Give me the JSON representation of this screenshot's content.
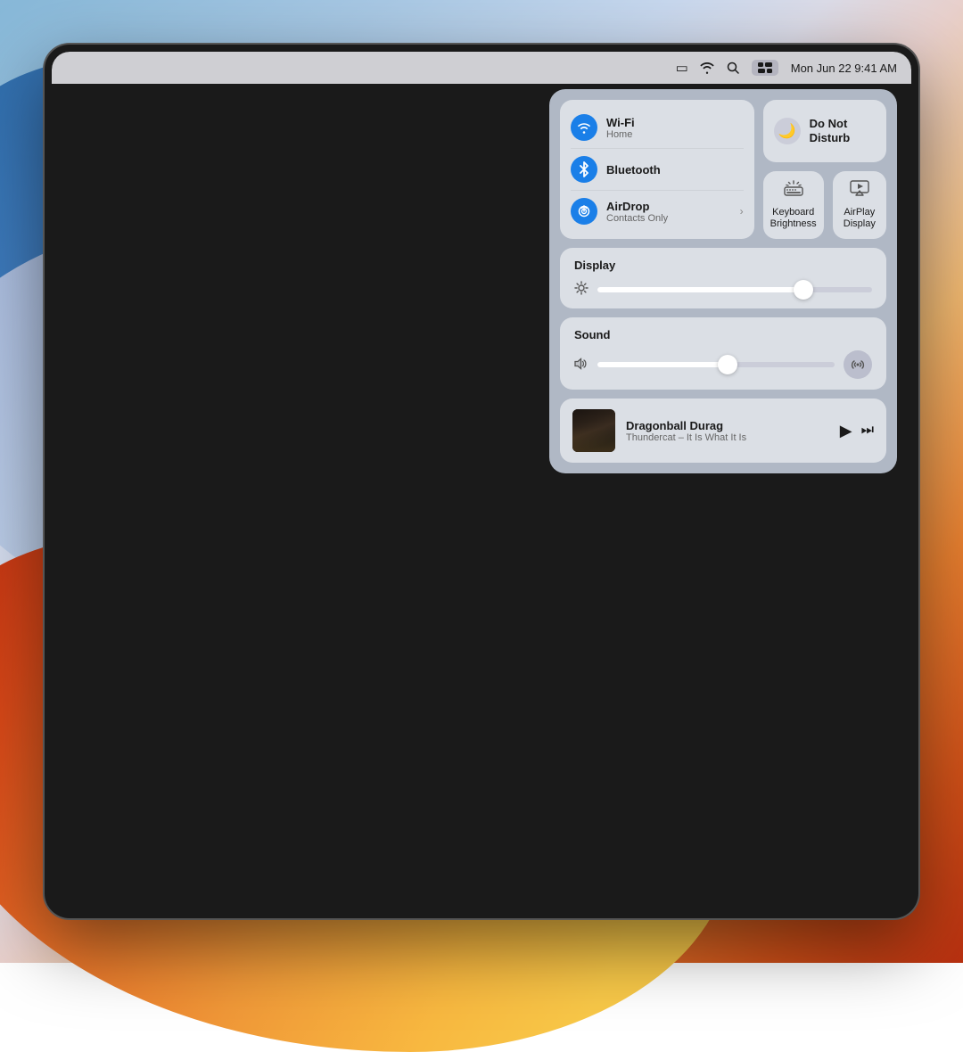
{
  "menubar": {
    "battery_icon": "▭",
    "wifi_icon": "wifi",
    "search_icon": "⌕",
    "control_center_icon": "⊞",
    "datetime": "Mon Jun 22   9:41 AM"
  },
  "control_center": {
    "connectivity": {
      "wifi": {
        "name": "Wi-Fi",
        "subtitle": "Home",
        "icon": "wifi"
      },
      "bluetooth": {
        "name": "Bluetooth",
        "subtitle": "",
        "icon": "bt"
      },
      "airdrop": {
        "name": "AirDrop",
        "subtitle": "Contacts Only",
        "icon": "airdrop"
      }
    },
    "dnd": {
      "label": "Do Not Disturb",
      "icon": "🌙"
    },
    "keyboard_brightness": {
      "label": "Keyboard\nBrightness",
      "icon": "☀"
    },
    "airplay_display": {
      "label": "AirPlay\nDisplay",
      "icon": "airplay"
    },
    "display": {
      "title": "Display",
      "slider_value": 75
    },
    "sound": {
      "title": "Sound",
      "slider_value": 55
    },
    "now_playing": {
      "track_title": "Dragonball Durag",
      "track_artist": "Thundercat – It Is What It Is",
      "play_icon": "▶",
      "skip_icon": "⏭"
    }
  }
}
